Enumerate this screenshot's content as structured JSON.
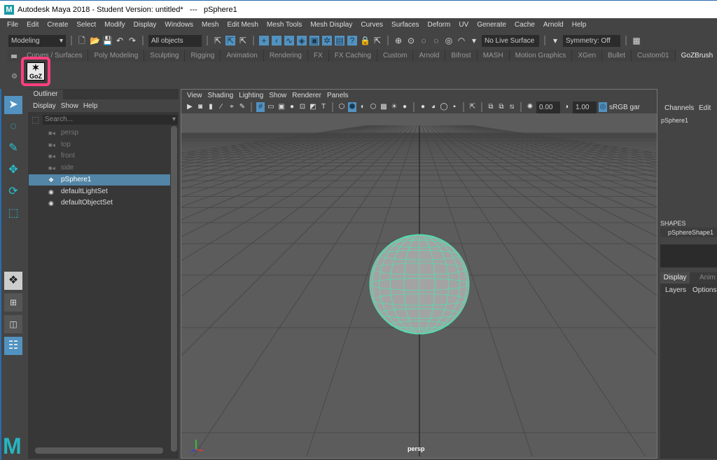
{
  "window": {
    "title": "Autodesk Maya 2018 - Student Version: untitled*   ---   pSphere1"
  },
  "menu": [
    "File",
    "Edit",
    "Create",
    "Select",
    "Modify",
    "Display",
    "Windows",
    "Mesh",
    "Edit Mesh",
    "Mesh Tools",
    "Mesh Display",
    "Curves",
    "Surfaces",
    "Deform",
    "UV",
    "Generate",
    "Cache",
    "Arnold",
    "Help"
  ],
  "statusline": {
    "menuset": "Modeling",
    "selection_filter": "All objects",
    "live_surface": "No Live Surface",
    "symmetry": "Symmetry: Off"
  },
  "shelf": {
    "tabs": [
      "Curves / Surfaces",
      "Poly Modeling",
      "Sculpting",
      "Rigging",
      "Animation",
      "Rendering",
      "FX",
      "FX Caching",
      "Custom",
      "Arnold",
      "Bifrost",
      "MASH",
      "Motion Graphics",
      "XGen",
      "Bullet",
      "Custom01",
      "GoZBrush"
    ],
    "active_tab": "GoZBrush",
    "goz_button": "GoZ",
    "highlight_color": "#ff3f7f"
  },
  "outliner": {
    "tab": "Outliner",
    "menu": [
      "Display",
      "Show",
      "Help"
    ],
    "search_placeholder": "Search...",
    "items": [
      {
        "label": "persp",
        "icon": "camera-icon",
        "dim": true
      },
      {
        "label": "top",
        "icon": "camera-icon",
        "dim": true
      },
      {
        "label": "front",
        "icon": "camera-icon",
        "dim": true
      },
      {
        "label": "side",
        "icon": "camera-icon",
        "dim": true
      },
      {
        "label": "pSphere1",
        "icon": "transform-icon",
        "selected": true
      },
      {
        "label": "defaultLightSet",
        "icon": "set-icon"
      },
      {
        "label": "defaultObjectSet",
        "icon": "set-icon"
      }
    ]
  },
  "viewport": {
    "menu": [
      "View",
      "Shading",
      "Lighting",
      "Show",
      "Renderer",
      "Panels"
    ],
    "exposure": "0.00",
    "gamma": "1.00",
    "color_space": "sRGB gar",
    "camera_label": "persp",
    "wireframe_color": "#4fe0b0"
  },
  "channelbox": {
    "tabs": [
      "Channels",
      "Edit"
    ],
    "object": "pSphere1",
    "shapes_header": "SHAPES",
    "shape": "pSphereShape1"
  },
  "layers": {
    "tabs": [
      "Display",
      "Anim"
    ],
    "menu": [
      "Layers",
      "Options"
    ]
  },
  "accent": "#5292c0"
}
